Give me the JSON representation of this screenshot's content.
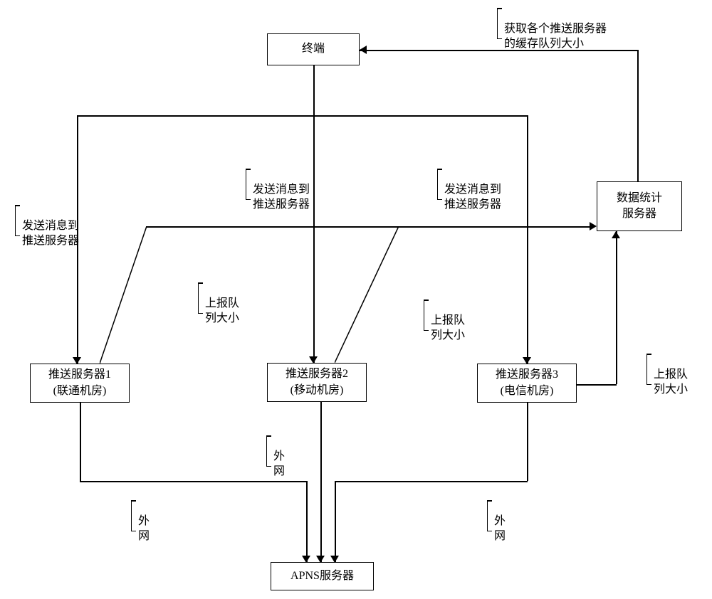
{
  "nodes": {
    "terminal": "终端",
    "stats_server": "数据统计\n服务器",
    "push_server_1": "推送服务器1\n(联通机房)",
    "push_server_2": "推送服务器2\n(移动机房)",
    "push_server_3": "推送服务器3\n(电信机房)",
    "apns_server": "APNS服务器"
  },
  "labels": {
    "get_cache_queue": "获取各个推送服务器\n的缓存队列大小",
    "send_to_push_left": "发送消息到\n推送服务器",
    "send_to_push_mid": "发送消息到\n推送服务器",
    "send_to_push_right": "发送消息到\n推送服务器",
    "report_queue_1": "上报队\n列大小",
    "report_queue_2": "上报队\n列大小",
    "report_queue_3": "上报队\n列大小",
    "external_net_1": "外\n网",
    "external_net_2": "外\n网",
    "external_net_3": "外\n网"
  }
}
